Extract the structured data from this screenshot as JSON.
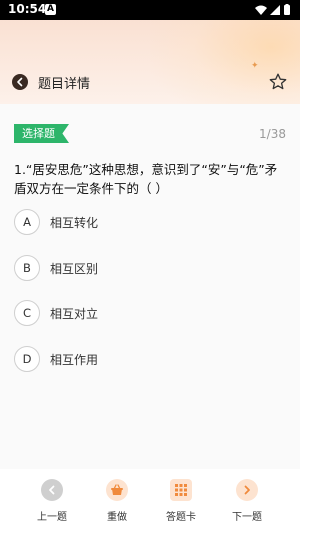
{
  "status_bar": {
    "time": "10:54",
    "notification": "A"
  },
  "header": {
    "title": "题目详情"
  },
  "question": {
    "type_tag": "选择题",
    "counter": "1/38",
    "text": "1.“居安思危”这种思想，意识到了“安”与“危”矛盾双方在一定条件下的（    ）",
    "options": [
      {
        "letter": "A",
        "text": "相互转化"
      },
      {
        "letter": "B",
        "text": "相互区别"
      },
      {
        "letter": "C",
        "text": "相互对立"
      },
      {
        "letter": "D",
        "text": "相互作用"
      }
    ]
  },
  "footer": {
    "prev_label": "上一题",
    "redo_label": "重做",
    "card_label": "答题卡",
    "next_label": "下一题"
  },
  "colors": {
    "accent_green": "#2db56a",
    "accent_orange": "#f08a3c",
    "disabled_gray": "#c8c8c8"
  }
}
